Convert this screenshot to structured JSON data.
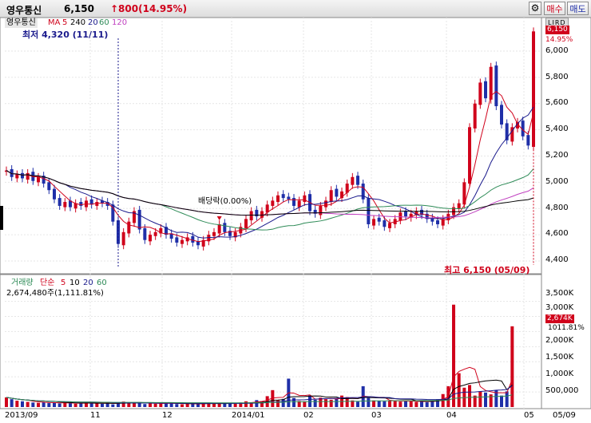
{
  "header": {
    "stock_name": "영우통신",
    "price": "6,150",
    "change": "↑800(14.95%)",
    "settings_icon": "gear-icon",
    "buy_label": "매수",
    "sell_label": "매도"
  },
  "mini_tabs": [
    "L",
    "I",
    "R",
    "D"
  ],
  "price_pane": {
    "legend_name": "영우통신",
    "ma_label": "MA",
    "ma_periods": [
      {
        "label": "5",
        "color": "#d0021b"
      },
      {
        "label": "240",
        "color": "#000000"
      },
      {
        "label": "20",
        "color": "#1a1a8c"
      },
      {
        "label": "60",
        "color": "#2e8b57"
      },
      {
        "label": "120",
        "color": "#c040c0"
      }
    ],
    "low_note": "최저 4,320 (11/11)",
    "high_note": "최고 6,150 (05/09)",
    "dividend_note": "배당락(0.00%)",
    "y_ticks": [
      "6,000",
      "5,800",
      "5,600",
      "5,400",
      "5,200",
      "5,000",
      "4,800",
      "4,600",
      "4,400"
    ],
    "price_tag": "6,150",
    "pct_tag": "14.95%"
  },
  "volume_pane": {
    "legend_name": "거래량",
    "legend_mode": "단순",
    "ma_periods": [
      {
        "label": "5",
        "color": "#d0021b"
      },
      {
        "label": "10",
        "color": "#000000"
      },
      {
        "label": "20",
        "color": "#1a1a8c"
      },
      {
        "label": "60",
        "color": "#2e8b57"
      }
    ],
    "volume_text": "2,674,480주(1,111.81%)",
    "y_ticks": [
      "3,500K",
      "3,000K",
      "2,500K",
      "2,000K",
      "1,500K",
      "1,000K",
      "500,000"
    ],
    "vol_tag": "2,674K",
    "pct_tag": "1011.81%"
  },
  "x_axis": {
    "labels": [
      "2013/09",
      "11",
      "12",
      "2014/01",
      "02",
      "03",
      "04",
      "05",
      "05/09"
    ]
  },
  "colors": {
    "up": "#d0021b",
    "down": "#1f2fa8",
    "ma5": "#d0021b",
    "ma20": "#1a1a8c",
    "ma60": "#2e8b57",
    "ma120": "#c040c0",
    "ma240": "#000000"
  },
  "chart_data": {
    "type": "candlestick",
    "price_range": [
      4300,
      6150
    ],
    "points": [
      {
        "close": 5090,
        "up": true
      },
      {
        "close": 5040,
        "up": false
      },
      {
        "close": 5060,
        "up": true
      },
      {
        "close": 5030,
        "up": false
      },
      {
        "close": 5070,
        "up": true
      },
      {
        "close": 5010,
        "up": false
      },
      {
        "close": 5040,
        "up": true
      },
      {
        "close": 4990,
        "up": false
      },
      {
        "close": 4940,
        "up": false
      },
      {
        "close": 4870,
        "up": false
      },
      {
        "close": 4820,
        "up": false
      },
      {
        "close": 4850,
        "up": true
      },
      {
        "close": 4810,
        "up": false
      },
      {
        "close": 4840,
        "up": true
      },
      {
        "close": 4820,
        "up": false
      },
      {
        "close": 4860,
        "up": true
      },
      {
        "close": 4830,
        "up": false
      },
      {
        "close": 4850,
        "up": true
      },
      {
        "close": 4840,
        "up": false
      },
      {
        "close": 4820,
        "up": false
      },
      {
        "close": 4700,
        "up": false
      },
      {
        "close": 4530,
        "up": false
      },
      {
        "close": 4620,
        "up": true
      },
      {
        "close": 4700,
        "up": true
      },
      {
        "close": 4780,
        "up": true
      },
      {
        "close": 4640,
        "up": false
      },
      {
        "close": 4560,
        "up": false
      },
      {
        "close": 4600,
        "up": true
      },
      {
        "close": 4620,
        "up": true
      },
      {
        "close": 4650,
        "up": true
      },
      {
        "close": 4600,
        "up": false
      },
      {
        "close": 4570,
        "up": false
      },
      {
        "close": 4540,
        "up": false
      },
      {
        "close": 4560,
        "up": true
      },
      {
        "close": 4580,
        "up": true
      },
      {
        "close": 4540,
        "up": false
      },
      {
        "close": 4520,
        "up": false
      },
      {
        "close": 4560,
        "up": true
      },
      {
        "close": 4600,
        "up": true
      },
      {
        "close": 4620,
        "up": true
      },
      {
        "close": 4680,
        "up": true
      },
      {
        "close": 4620,
        "up": false
      },
      {
        "close": 4590,
        "up": false
      },
      {
        "close": 4620,
        "up": true
      },
      {
        "close": 4660,
        "up": true
      },
      {
        "close": 4720,
        "up": true
      },
      {
        "close": 4780,
        "up": true
      },
      {
        "close": 4740,
        "up": false
      },
      {
        "close": 4780,
        "up": true
      },
      {
        "close": 4830,
        "up": true
      },
      {
        "close": 4860,
        "up": true
      },
      {
        "close": 4900,
        "up": true
      },
      {
        "close": 4880,
        "up": false
      },
      {
        "close": 4870,
        "up": false
      },
      {
        "close": 4820,
        "up": false
      },
      {
        "close": 4860,
        "up": true
      },
      {
        "close": 4900,
        "up": true
      },
      {
        "close": 4780,
        "up": false
      },
      {
        "close": 4760,
        "up": false
      },
      {
        "close": 4820,
        "up": true
      },
      {
        "close": 4860,
        "up": true
      },
      {
        "close": 4940,
        "up": true
      },
      {
        "close": 4890,
        "up": false
      },
      {
        "close": 4930,
        "up": true
      },
      {
        "close": 4990,
        "up": true
      },
      {
        "close": 5040,
        "up": true
      },
      {
        "close": 4980,
        "up": false
      },
      {
        "close": 4870,
        "up": false
      },
      {
        "close": 4680,
        "up": false
      },
      {
        "close": 4720,
        "up": true
      },
      {
        "close": 4700,
        "up": false
      },
      {
        "close": 4660,
        "up": false
      },
      {
        "close": 4690,
        "up": true
      },
      {
        "close": 4720,
        "up": true
      },
      {
        "close": 4770,
        "up": true
      },
      {
        "close": 4740,
        "up": false
      },
      {
        "close": 4760,
        "up": true
      },
      {
        "close": 4780,
        "up": true
      },
      {
        "close": 4750,
        "up": false
      },
      {
        "close": 4720,
        "up": false
      },
      {
        "close": 4700,
        "up": false
      },
      {
        "close": 4680,
        "up": false
      },
      {
        "close": 4720,
        "up": true
      },
      {
        "close": 4760,
        "up": true
      },
      {
        "close": 4810,
        "up": true
      },
      {
        "close": 4840,
        "up": true
      },
      {
        "close": 5000,
        "up": true
      },
      {
        "close": 5420,
        "up": true
      },
      {
        "close": 5600,
        "up": true
      },
      {
        "close": 5760,
        "up": true
      },
      {
        "close": 5640,
        "up": false
      },
      {
        "close": 5880,
        "up": true
      },
      {
        "close": 5580,
        "up": false
      },
      {
        "close": 5440,
        "up": false
      },
      {
        "close": 5320,
        "up": false
      },
      {
        "close": 5420,
        "up": true
      },
      {
        "close": 5460,
        "up": true
      },
      {
        "close": 5350,
        "up": false
      },
      {
        "close": 5280,
        "up": false
      },
      {
        "close": 6150,
        "up": true
      }
    ],
    "volume_k": [
      320,
      260,
      210,
      190,
      170,
      150,
      140,
      160,
      130,
      150,
      120,
      140,
      130,
      110,
      120,
      150,
      130,
      120,
      110,
      140,
      90,
      150,
      180,
      140,
      160,
      130,
      100,
      120,
      110,
      130,
      140,
      120,
      100,
      90,
      110,
      120,
      100,
      130,
      110,
      120,
      140,
      130,
      120,
      110,
      150,
      190,
      160,
      230,
      190,
      360,
      560,
      230,
      270,
      940,
      300,
      200,
      190,
      380,
      240,
      310,
      260,
      240,
      280,
      380,
      330,
      220,
      180,
      690,
      300,
      220,
      210,
      190,
      200,
      220,
      180,
      200,
      190,
      170,
      190,
      160,
      210,
      260,
      430,
      690,
      3390,
      1120,
      640,
      730,
      380,
      520,
      480,
      420,
      560,
      380,
      520,
      2674
    ],
    "y_axis_volume_max_k": 3700
  }
}
